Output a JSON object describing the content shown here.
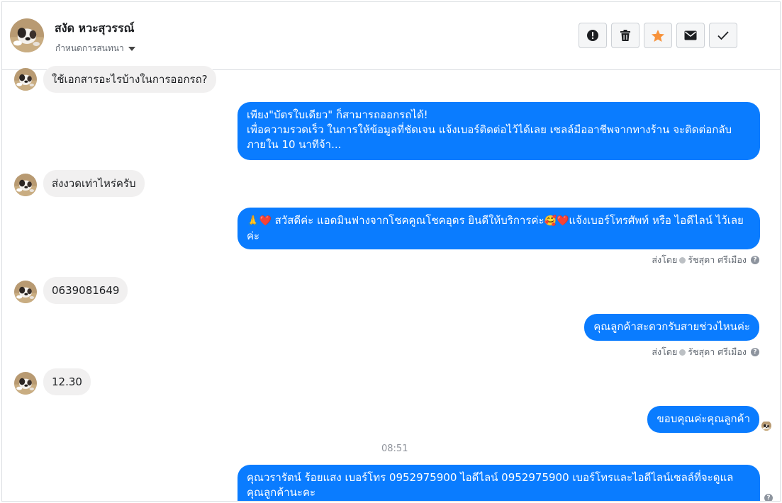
{
  "header": {
    "contact_name": "สงัด หวะสุวรรณ์",
    "assign_label": "กำหนดการสนทนา"
  },
  "actions": [
    {
      "name": "report-icon"
    },
    {
      "name": "trash-icon"
    },
    {
      "name": "star-icon",
      "color": "#f7923b"
    },
    {
      "name": "mail-icon"
    },
    {
      "name": "check-icon"
    }
  ],
  "messages": {
    "m1": "ใช้เอกสารอะไรบ้างในการออกรถ?",
    "m2_line1": "เพียง\"บัตรใบเดียว\" ก็สามารถออกรถได้!",
    "m2_line2": "เพื่อความรวดเร็ว ในการให้ข้อมูลที่ชัดเจน แจ้งเบอร์ติดต่อไว้ได้เลย เซลล์มืออาชีพจากทางร้าน จะติดต่อกลับ",
    "m2_line3": "ภายใน 10 นาทีจ้า...",
    "m3": "ส่งงวดเท่าไหร่ครับ",
    "m4_emoji1": "🙏",
    "m4_emoji2": "❤️",
    "m4_text1": "สวัสดีค่ะ แอดมินฟางจากโชคคูณโชคอุดร ยินดีให้บริการค่ะ",
    "m4_emoji3": "🥰",
    "m4_emoji4": "❤️",
    "m4_text2": "แจ้งเบอร์โทรศัพท์ หรือ ไอดีไลน์  ไว้เลย",
    "m4_line2": "ค่ะ",
    "m5": "0639081649",
    "m6": "คุณลูกค้าสะดวกรับสายช่วงไหนค่ะ",
    "m7": "12.30",
    "m8": "ขอบคุณค่ะคุณลูกค้า",
    "m9_line1": "คุณวรารัตน์ ร้อยแสง        เบอร์โทร 0952975900  ไอดีไลน์ 0952975900   เบอร์โทรและไอดีไลน์เซลล์ที่จะดูแล",
    "m9_line2": "คุณลูกค้านะคะ"
  },
  "sent_by": {
    "prefix": "ส่งโดย",
    "agent": "รัชสุดา ศรีเมือง",
    "help": "?"
  },
  "timestamp": "08:51",
  "colors": {
    "outgoing": "#0a7cff",
    "incoming": "#f1f0f0"
  }
}
